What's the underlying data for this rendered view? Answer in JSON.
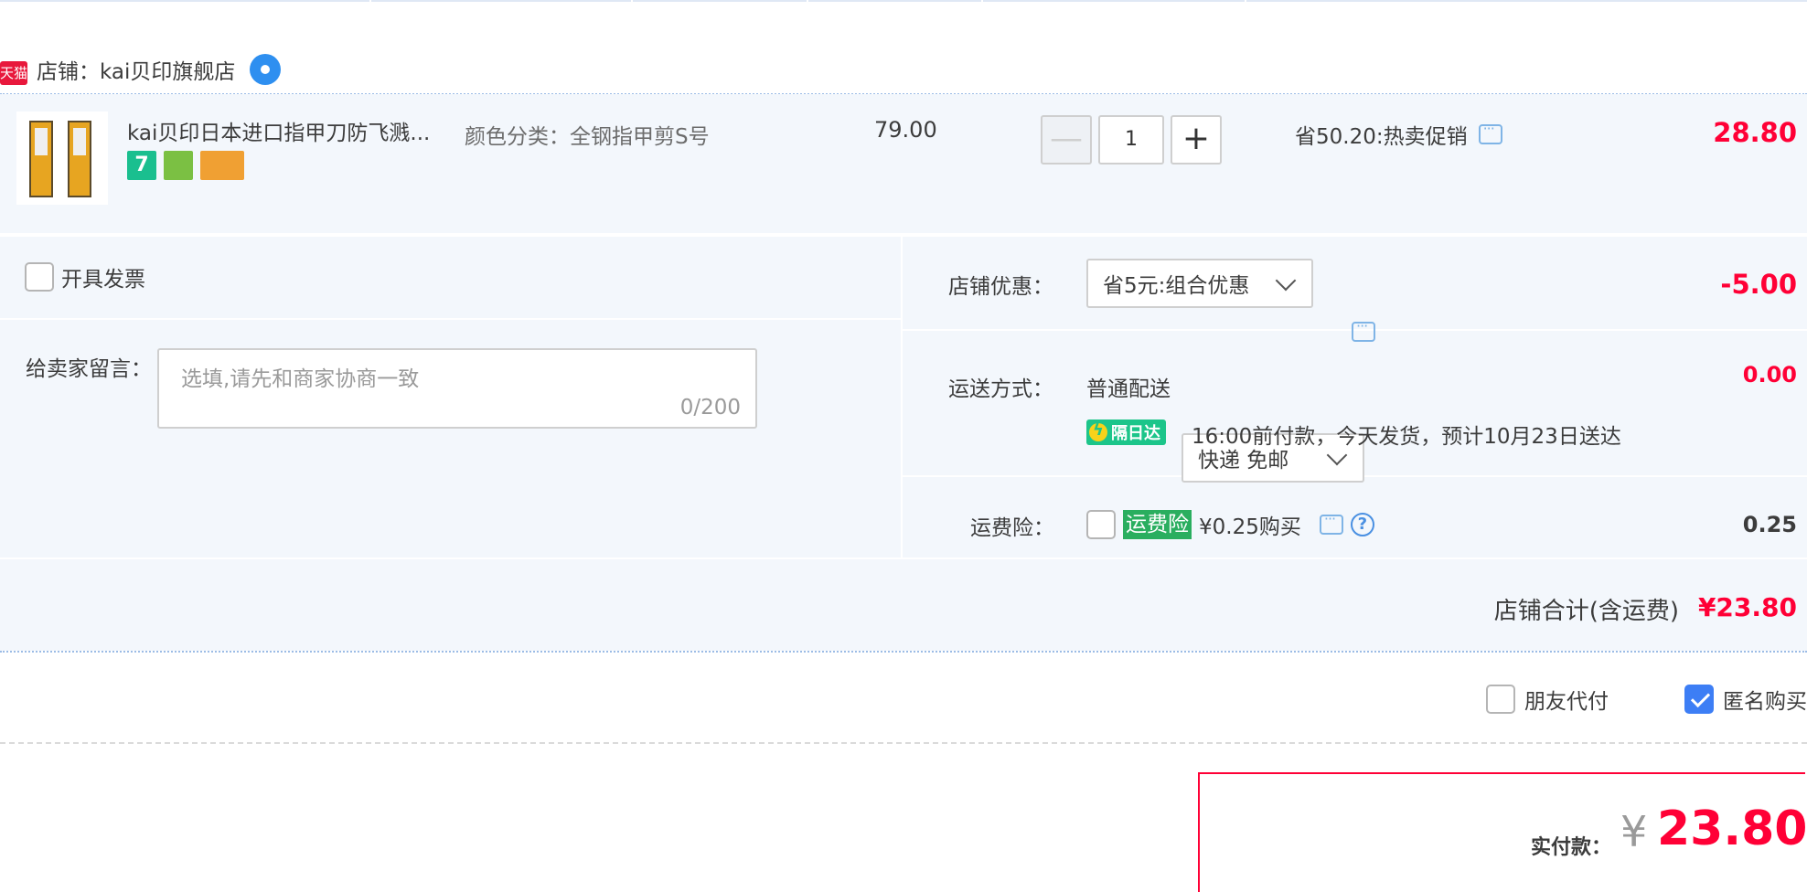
{
  "shop": {
    "badge": "天猫",
    "label": "店铺：kai贝印旗舰店"
  },
  "item": {
    "title": "kai贝印日本进口指甲刀防飞溅...",
    "tags": [
      "7",
      "",
      ""
    ],
    "sku": "颜色分类：全钢指甲剪S号",
    "unit_price": "79.00",
    "quantity": {
      "minus": "—",
      "value": "1",
      "plus": "+"
    },
    "promo": "省50.20:热卖促销",
    "total": "28.80"
  },
  "invoice": {
    "label": "开具发票",
    "checked": false
  },
  "message": {
    "label": "给卖家留言：",
    "placeholder": "选填,请先和商家协商一致",
    "count": "0/200"
  },
  "shop_discount": {
    "label": "店铺优惠：",
    "selected": "省5元:组合优惠",
    "amount": "-5.00"
  },
  "shipping": {
    "label": "运送方式：",
    "method": "普通配送",
    "selected": "快递 免邮",
    "amount": "0.00",
    "badge": "隔日达",
    "eta": "16:00前付款，今天发货，预计10月23日送达"
  },
  "insurance": {
    "label": "运费险：",
    "badge": "运费险",
    "price": "¥0.25购买",
    "help": "?",
    "amount": "0.25"
  },
  "shop_total": {
    "label": "店铺合计(含运费)",
    "amount": "¥23.80"
  },
  "options": {
    "friend_pay": "朋友代付",
    "anonymous": "匿名购买",
    "anonymous_checked": true
  },
  "payment": {
    "label": "实付款：",
    "currency": "¥",
    "amount": "23.80"
  },
  "colors": {
    "accent_red": "#ff0036",
    "bg_blue": "#f3f7fc",
    "checkbox_blue": "#3d7ef5"
  }
}
